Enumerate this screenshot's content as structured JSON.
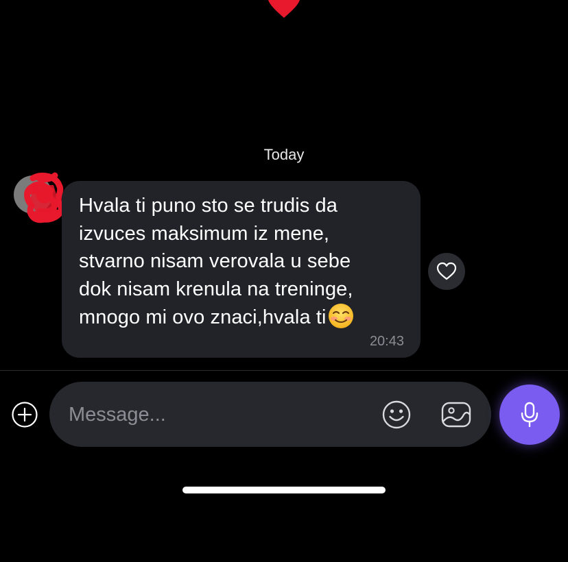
{
  "chat": {
    "date_separator": "Today",
    "message": {
      "lines": [
        "Hvala ti puno sto se trudis da",
        "izvuces maksimum iz mene,",
        "stvarno nisam verovala u sebe",
        "dok nisam krenula na treninge,",
        "mnogo mi ovo znaci,hvala ti"
      ],
      "emoji": "smiling-face-with-smiling-eyes",
      "time": "20:43"
    }
  },
  "composer": {
    "placeholder": "Message..."
  },
  "colors": {
    "background": "#000000",
    "bubble": "#212329",
    "input": "#26282d",
    "accent": "#7b5cf0",
    "heart": "#e8192c"
  },
  "icons": {
    "top": "red-heart-icon",
    "reaction": "heart-outline-icon",
    "add": "plus-circle-icon",
    "emoji": "smiley-icon",
    "gallery": "image-icon",
    "mic": "microphone-icon"
  }
}
